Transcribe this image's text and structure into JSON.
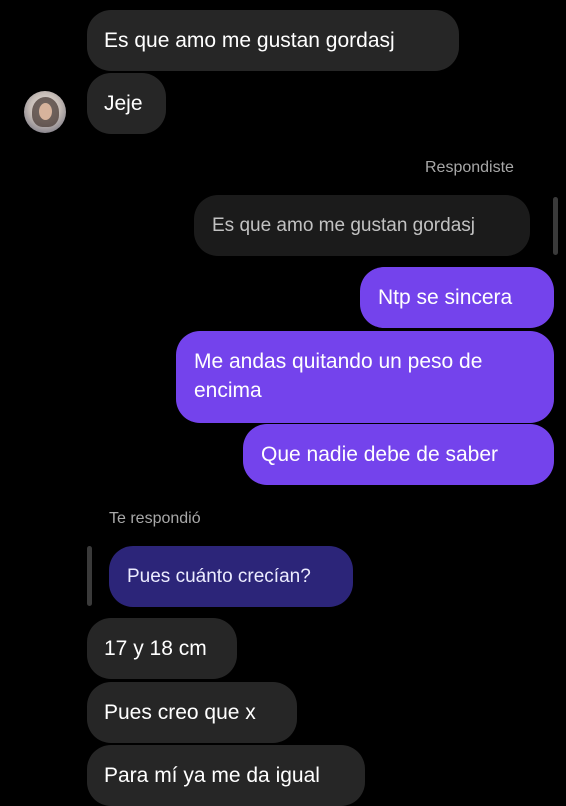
{
  "conversation": {
    "messages": [
      {
        "direction": "incoming",
        "text": "Es que amo me gustan gordasj"
      },
      {
        "direction": "incoming",
        "text": "Jeje"
      },
      {
        "direction": "outgoing",
        "reply_label": "Respondiste",
        "quoted_text": "Es que amo me gustan gordasj"
      },
      {
        "direction": "outgoing",
        "text": "Ntp se sincera"
      },
      {
        "direction": "outgoing",
        "text_line1": "Me andas quitando un peso de",
        "text_line2": "encima"
      },
      {
        "direction": "outgoing",
        "text": "Que nadie debe de saber"
      },
      {
        "direction": "incoming",
        "reply_label": "Te respondió",
        "quoted_text": "Pues cuánto crecían?"
      },
      {
        "direction": "incoming",
        "text": "17 y 18 cm"
      },
      {
        "direction": "incoming",
        "text": "Pues creo que x"
      },
      {
        "direction": "incoming",
        "text": "Para mí ya me da igual"
      }
    ]
  },
  "colors": {
    "background": "#000000",
    "incoming_bubble": "#262626",
    "outgoing_bubble": "#7443ec",
    "quoted_outgoing": "#1b1b1b",
    "quoted_incoming": "#2c2579"
  },
  "icons": {
    "avatar": "contact-avatar"
  }
}
